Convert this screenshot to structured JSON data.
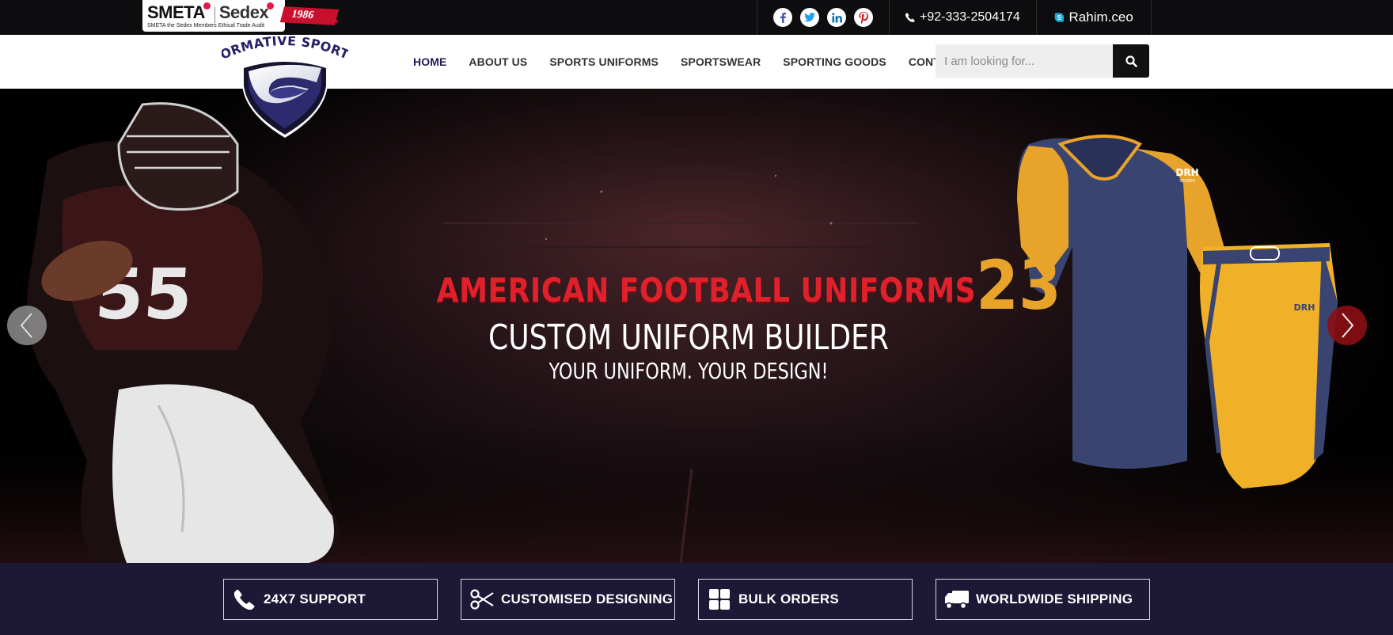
{
  "topbar": {
    "badge": {
      "smeta": "SMETA",
      "sedex": "Sedex",
      "caption": "SMETA the Sedex Members Ethical Trade Audit"
    },
    "ribbon_year": "1986",
    "social": [
      {
        "icon": "facebook-icon",
        "glyph": "f",
        "color": "#3b5998"
      },
      {
        "icon": "twitter-icon",
        "glyph": "t",
        "color": "#1da1f2"
      },
      {
        "icon": "linkedin-icon",
        "glyph": "in",
        "color": "#0e76a8"
      },
      {
        "icon": "pinterest-icon",
        "glyph": "p",
        "color": "#cb2027"
      }
    ],
    "phone": "+92-333-2504174",
    "skype": "Rahim.ceo"
  },
  "logo": {
    "name": "FORMATIVE SPORTS"
  },
  "nav": {
    "items": [
      {
        "label": "HOME",
        "active": true
      },
      {
        "label": "ABOUT US"
      },
      {
        "label": "SPORTS UNIFORMS"
      },
      {
        "label": "SPORTSWEAR"
      },
      {
        "label": "SPORTING GOODS"
      },
      {
        "label": "CONTACT"
      }
    ]
  },
  "search": {
    "placeholder": "I am looking for...",
    "icon": "search-icon"
  },
  "hero": {
    "title": "AMERICAN FOOTBALL UNIFORMS",
    "subtitle": "CUSTOM UNIFORM BUILDER",
    "tagline": "YOUR UNIFORM. YOUR DESIGN!",
    "jersey_number": "23",
    "player_number": "55",
    "brand_mark": "DRH",
    "brand_sub": "SPORTS"
  },
  "features": [
    {
      "label": "24X7 SUPPORT",
      "icon": "phone-icon"
    },
    {
      "label": "CUSTOMISED DESIGNING",
      "icon": "scissors-icon"
    },
    {
      "label": "BULK ORDERS",
      "icon": "grid-icon"
    },
    {
      "label": "WORLDWIDE SHIPPING",
      "icon": "truck-icon"
    }
  ],
  "colors": {
    "topbar": "#0d0c0e",
    "nav_active": "#1f1a57",
    "features_bg": "#1d1836",
    "hero_red": "#e0202a",
    "jersey_navy": "#3a4470",
    "jersey_gold": "#e8a42a"
  }
}
